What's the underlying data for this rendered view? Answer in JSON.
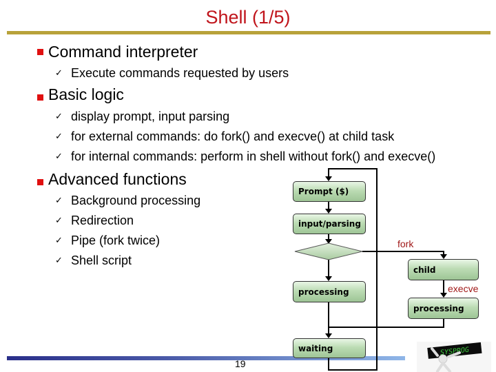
{
  "slide": {
    "title": "Shell (1/5)",
    "page_number": "19",
    "logo_text": "SYSPROG"
  },
  "sections": [
    {
      "heading": "Command interpreter",
      "items": [
        "Execute commands requested by users"
      ]
    },
    {
      "heading": "Basic logic",
      "items": [
        "display prompt, input parsing",
        "for external commands: do fork() and execve() at child task",
        "for internal commands: perform in shell without fork() and execve()"
      ]
    },
    {
      "heading": "Advanced functions",
      "items": [
        "Background processing",
        "Redirection",
        "Pipe (fork twice)",
        "Shell script"
      ]
    }
  ],
  "flowchart": {
    "nodes": {
      "prompt": "Prompt ($)",
      "input": "input/parsing",
      "processing": "processing",
      "waiting": "waiting",
      "child": "child",
      "child_processing": "processing"
    },
    "edge_labels": {
      "fork": "fork",
      "execve": "execve"
    }
  },
  "colors": {
    "title": "#c0141b",
    "bullet": "#e01010",
    "rule": "#b8a23a",
    "edge_label": "#a01818"
  }
}
